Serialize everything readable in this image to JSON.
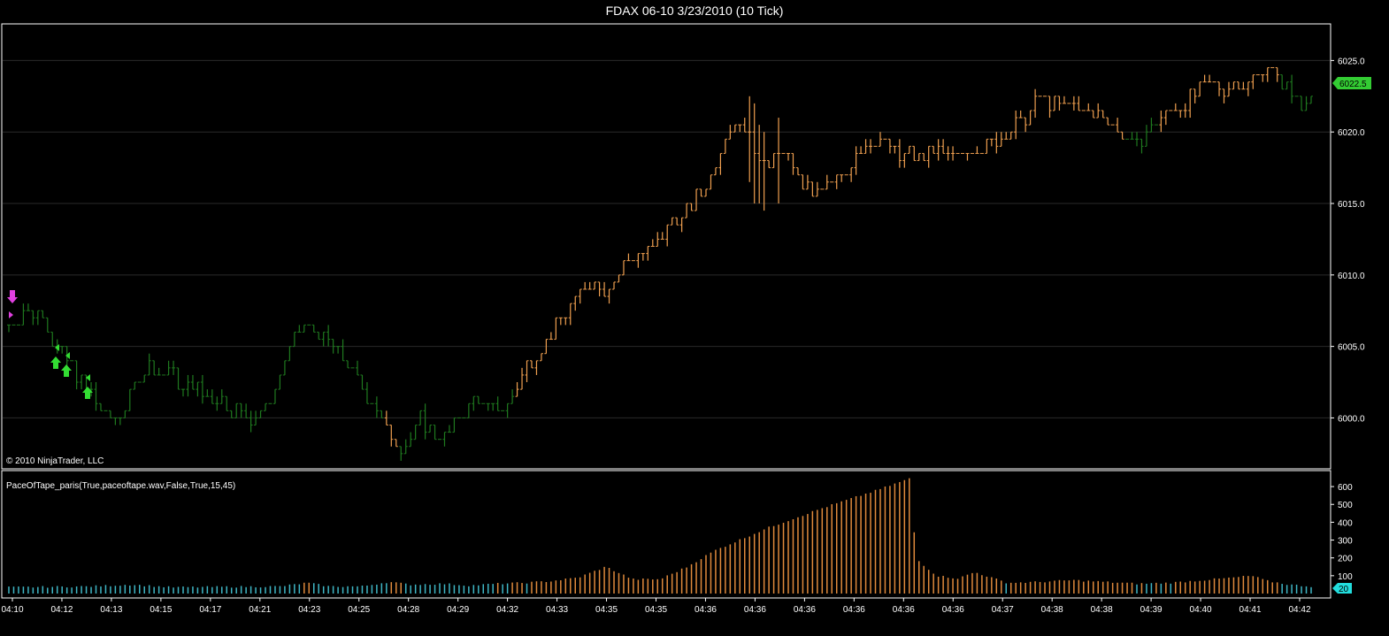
{
  "window": {
    "title": "FDAX 06-10  3/23/2010 (10 Tick)"
  },
  "colors": {
    "background": "#000000",
    "up_bar": "#1f7a1f",
    "down_bar": "#f0a050",
    "grid": "#2a2a2a",
    "last_price_badge": "#33cc33",
    "pace_normal": "#3fb7c6",
    "pace_high": "#e08a3c",
    "signal_down": "#e040e0",
    "signal_up": "#33dd33",
    "pace_badge": "#22dddd"
  },
  "price_panel": {
    "copyright": "© 2010 NinjaTrader, LLC",
    "last_price": "6022.5"
  },
  "indicator_panel": {
    "label": "PaceOfTape_paris(True,paceoftape.wav,False,True,15,45)",
    "current_value": "20"
  },
  "chart_data": [
    {
      "type": "ohlc-tick",
      "title": "FDAX 06-10  3/23/2010 (10 Tick)",
      "ylim": [
        5996.5,
        6027.5
      ],
      "y_ticks": [
        "6025.0",
        "6020.0",
        "6015.0",
        "6010.0",
        "6005.0",
        "6000.0"
      ],
      "y_tick_values": [
        6025.0,
        6020.0,
        6015.0,
        6010.0,
        6005.0,
        6000.0
      ],
      "x_tick_labels": [
        "04:10",
        "04:12",
        "04:13",
        "04:15",
        "04:17",
        "04:21",
        "04:23",
        "04:25",
        "04:28",
        "04:29",
        "04:32",
        "04:33",
        "04:35",
        "04:35",
        "04:36",
        "04:36",
        "04:36",
        "04:36",
        "04:36",
        "04:36",
        "04:37",
        "04:38",
        "04:38",
        "04:39",
        "04:40",
        "04:41",
        "04:42"
      ],
      "grid": true,
      "bar_count": 270,
      "path_points": [
        [
          0,
          6006.5
        ],
        [
          6,
          6007.5
        ],
        [
          12,
          6007.5
        ],
        [
          17,
          6005.0
        ],
        [
          22,
          6004.0
        ],
        [
          27,
          6002.5
        ],
        [
          31,
          6001.5
        ],
        [
          36,
          6000.0
        ],
        [
          40,
          6000.0
        ],
        [
          44,
          6001.0
        ],
        [
          48,
          6003.0
        ],
        [
          52,
          6004.0
        ],
        [
          56,
          6003.0
        ],
        [
          60,
          6003.5
        ],
        [
          64,
          6002.0
        ],
        [
          68,
          6002.5
        ],
        [
          72,
          6001.5
        ],
        [
          76,
          6001.5
        ],
        [
          80,
          6001.0
        ],
        [
          84,
          6000.5
        ],
        [
          88,
          6000.0
        ],
        [
          92,
          6000.5
        ],
        [
          96,
          6001.0
        ],
        [
          100,
          6003.0
        ],
        [
          104,
          6005.0
        ],
        [
          108,
          6006.5
        ],
        [
          112,
          6006.0
        ],
        [
          116,
          6005.5
        ],
        [
          120,
          6005.0
        ],
        [
          124,
          6004.0
        ],
        [
          128,
          6003.0
        ],
        [
          132,
          6001.5
        ],
        [
          136,
          6000.5
        ],
        [
          140,
          5999.0
        ],
        [
          144,
          5998.0
        ],
        [
          148,
          5998.5
        ],
        [
          152,
          6000.0
        ],
        [
          156,
          5999.0
        ],
        [
          160,
          5998.5
        ],
        [
          164,
          5999.5
        ],
        [
          168,
          6000.5
        ],
        [
          172,
          6001.5
        ],
        [
          176,
          6000.5
        ],
        [
          180,
          6000.5
        ],
        [
          184,
          6001.0
        ],
        [
          188,
          6002.5
        ],
        [
          192,
          6004.0
        ],
        [
          196,
          6005.0
        ],
        [
          200,
          6006.0
        ],
        [
          204,
          6007.0
        ],
        [
          208,
          6008.0
        ],
        [
          212,
          6009.5
        ],
        [
          216,
          6009.5
        ],
        [
          220,
          6009.0
        ],
        [
          224,
          6010.0
        ],
        [
          228,
          6011.0
        ],
        [
          232,
          6011.5
        ],
        [
          236,
          6011.5
        ],
        [
          240,
          6012.5
        ],
        [
          244,
          6014.0
        ],
        [
          248,
          6014.0
        ],
        [
          252,
          6015.0
        ],
        [
          256,
          6016.0
        ],
        [
          260,
          6017.5
        ],
        [
          264,
          6020.0
        ],
        [
          268,
          6021.0
        ],
        [
          272,
          6020.0
        ],
        [
          276,
          6018.5
        ],
        [
          280,
          6018.0
        ],
        [
          284,
          6018.5
        ],
        [
          288,
          6018.0
        ],
        [
          292,
          6016.5
        ],
        [
          296,
          6015.5
        ],
        [
          300,
          6016.0
        ],
        [
          304,
          6016.5
        ],
        [
          308,
          6017.0
        ],
        [
          312,
          6018.5
        ],
        [
          316,
          6019.0
        ],
        [
          320,
          6019.5
        ],
        [
          324,
          6019.0
        ],
        [
          328,
          6018.0
        ],
        [
          332,
          6018.5
        ],
        [
          336,
          6018.0
        ],
        [
          340,
          6019.0
        ],
        [
          344,
          6018.5
        ],
        [
          348,
          6018.0
        ],
        [
          352,
          6018.5
        ],
        [
          356,
          6019.0
        ],
        [
          360,
          6019.0
        ],
        [
          364,
          6019.5
        ],
        [
          368,
          6020.0
        ],
        [
          372,
          6020.5
        ],
        [
          376,
          6021.0
        ],
        [
          380,
          6022.5
        ],
        [
          384,
          6022.0
        ],
        [
          388,
          6021.5
        ],
        [
          392,
          6022.0
        ],
        [
          396,
          6021.5
        ],
        [
          400,
          6021.0
        ],
        [
          404,
          6021.5
        ],
        [
          408,
          6020.0
        ],
        [
          412,
          6019.5
        ],
        [
          416,
          6019.0
        ],
        [
          420,
          6020.0
        ],
        [
          424,
          6021.0
        ],
        [
          428,
          6021.5
        ],
        [
          432,
          6022.0
        ],
        [
          436,
          6022.5
        ],
        [
          440,
          6023.0
        ],
        [
          444,
          6023.5
        ],
        [
          448,
          6023.0
        ],
        [
          452,
          6023.5
        ],
        [
          456,
          6023.0
        ],
        [
          460,
          6024.0
        ],
        [
          464,
          6025.0
        ],
        [
          468,
          6023.5
        ],
        [
          472,
          6023.0
        ],
        [
          476,
          6022.0
        ],
        [
          480,
          6022.5
        ]
      ]
    },
    {
      "type": "bar",
      "title": "PaceOfTape_paris(True,paceoftape.wav,False,True,15,45)",
      "ylim": [
        0,
        650
      ],
      "y_ticks": [
        "600",
        "500",
        "400",
        "300",
        "200",
        "100"
      ],
      "y_tick_values": [
        600,
        500,
        400,
        300,
        200,
        100
      ],
      "threshold": 45,
      "bar_count": 270,
      "profile_points": [
        [
          0,
          35
        ],
        [
          30,
          40
        ],
        [
          45,
          50
        ],
        [
          60,
          35
        ],
        [
          100,
          40
        ],
        [
          110,
          60
        ],
        [
          118,
          40
        ],
        [
          130,
          40
        ],
        [
          140,
          65
        ],
        [
          148,
          50
        ],
        [
          160,
          55
        ],
        [
          170,
          45
        ],
        [
          180,
          55
        ],
        [
          190,
          60
        ],
        [
          200,
          70
        ],
        [
          210,
          90
        ],
        [
          220,
          150
        ],
        [
          230,
          80
        ],
        [
          240,
          80
        ],
        [
          250,
          150
        ],
        [
          260,
          240
        ],
        [
          280,
          370
        ],
        [
          300,
          480
        ],
        [
          320,
          580
        ],
        [
          333,
          650
        ],
        [
          334,
          200
        ],
        [
          338,
          150
        ],
        [
          342,
          100
        ],
        [
          350,
          85
        ],
        [
          356,
          120
        ],
        [
          362,
          90
        ],
        [
          368,
          60
        ],
        [
          380,
          65
        ],
        [
          392,
          75
        ],
        [
          404,
          65
        ],
        [
          416,
          55
        ],
        [
          428,
          60
        ],
        [
          440,
          75
        ],
        [
          452,
          90
        ],
        [
          458,
          100
        ],
        [
          464,
          70
        ],
        [
          472,
          50
        ],
        [
          480,
          40
        ]
      ]
    }
  ]
}
